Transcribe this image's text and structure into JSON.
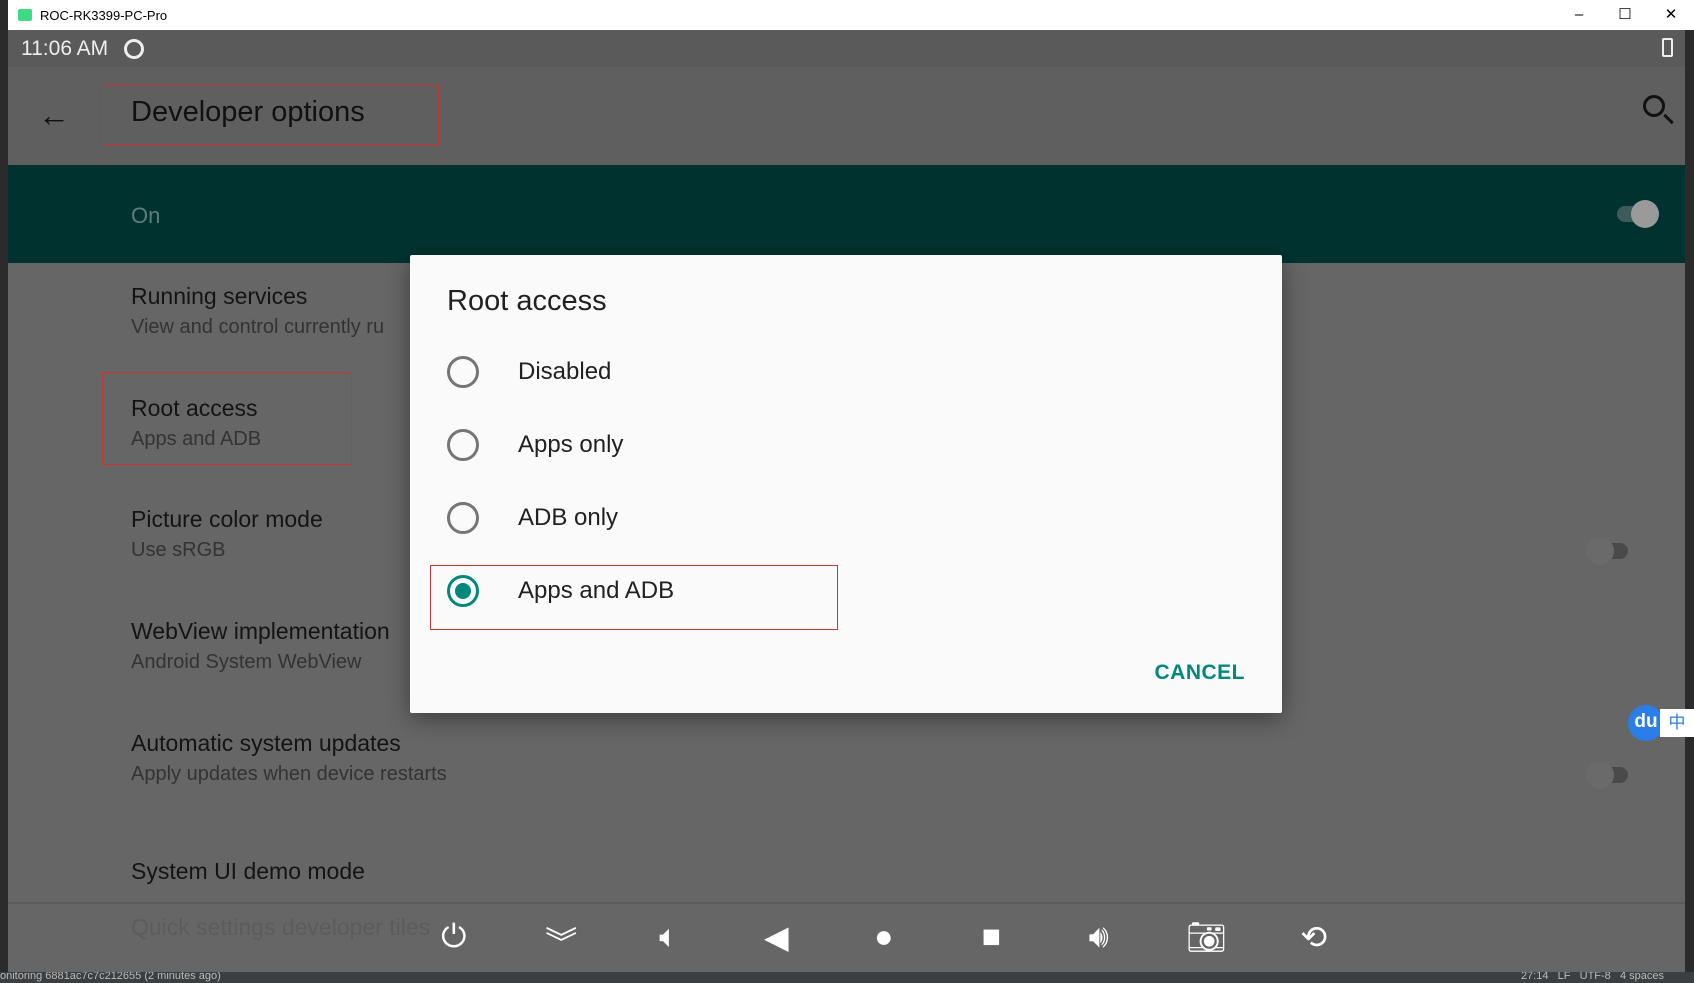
{
  "window": {
    "title": "ROC-RK3399-PC-Pro",
    "minimize": "–",
    "maximize": "☐",
    "close": "✕"
  },
  "status_bar": {
    "time": "11:06 AM"
  },
  "toolbar": {
    "title": "Developer options",
    "back_icon": "arrow-left",
    "search_icon": "search"
  },
  "master_switch": {
    "label": "On",
    "on": true
  },
  "settings": [
    {
      "title": "Running services",
      "subtitle": "View and control currently ru"
    },
    {
      "title": "Root access",
      "subtitle": "Apps and ADB"
    },
    {
      "title": "Picture color mode",
      "subtitle": "Use sRGB",
      "toggle": false
    },
    {
      "title": "WebView implementation",
      "subtitle": "Android System WebView"
    },
    {
      "title": "Automatic system updates",
      "subtitle": "Apply updates when device restarts",
      "toggle": false
    },
    {
      "title": "System UI demo mode"
    },
    {
      "title": "Quick settings developer tiles"
    }
  ],
  "dialog": {
    "title": "Root access",
    "options": [
      {
        "label": "Disabled",
        "selected": false
      },
      {
        "label": "Apps only",
        "selected": false
      },
      {
        "label": "ADB only",
        "selected": false
      },
      {
        "label": "Apps and ADB",
        "selected": true
      }
    ],
    "cancel": "CANCEL"
  },
  "nav_buttons": [
    "power",
    "notifications",
    "volume-down",
    "back",
    "home",
    "recents",
    "volume-up",
    "screenshot",
    "rotate"
  ],
  "ime": {
    "logo": "du",
    "mode": "中"
  },
  "ide_status": {
    "left": "onitoring 6881ac7c7c212655 (2 minutes ago)",
    "right": "27:14   LF   UTF-8   4 spaces"
  },
  "colors": {
    "accent": "#00897b",
    "switch_bar": "#003330",
    "highlight": "#cc3333"
  }
}
